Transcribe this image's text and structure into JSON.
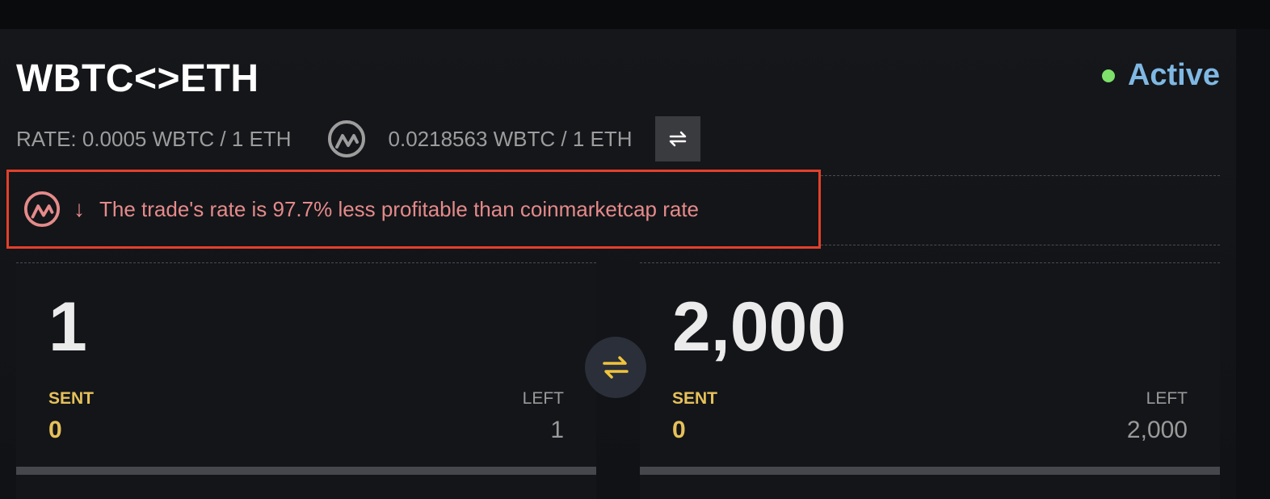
{
  "pair_title": "WBTC<>ETH",
  "status": {
    "label": "Active",
    "dot_color": "#7ee06a",
    "label_color": "#7fb8e3"
  },
  "rate": {
    "label": "RATE: 0.0005 WBTC / 1 ETH",
    "cmc_rate": "0.0218563 WBTC / 1 ETH",
    "cmc_icon": "coinmarketcap-icon",
    "swap_icon": "swap-arrows-icon"
  },
  "warning": {
    "icon": "coinmarketcap-icon",
    "arrow": "↓",
    "text": "The trade's rate is 97.7% less profitable than coinmarketcap rate",
    "color": "#e58a8a",
    "border_color": "#e3402b"
  },
  "cards": [
    {
      "amount": "1",
      "sent_label": "SENT",
      "sent_value": "0",
      "left_label": "LEFT",
      "left_value": "1",
      "progress": 0
    },
    {
      "amount": "2,000",
      "sent_label": "SENT",
      "sent_value": "0",
      "left_label": "LEFT",
      "left_value": "2,000",
      "progress": 0
    }
  ],
  "center_swap_icon": "swap-arrows-icon",
  "accent_color": "#e6c15a"
}
